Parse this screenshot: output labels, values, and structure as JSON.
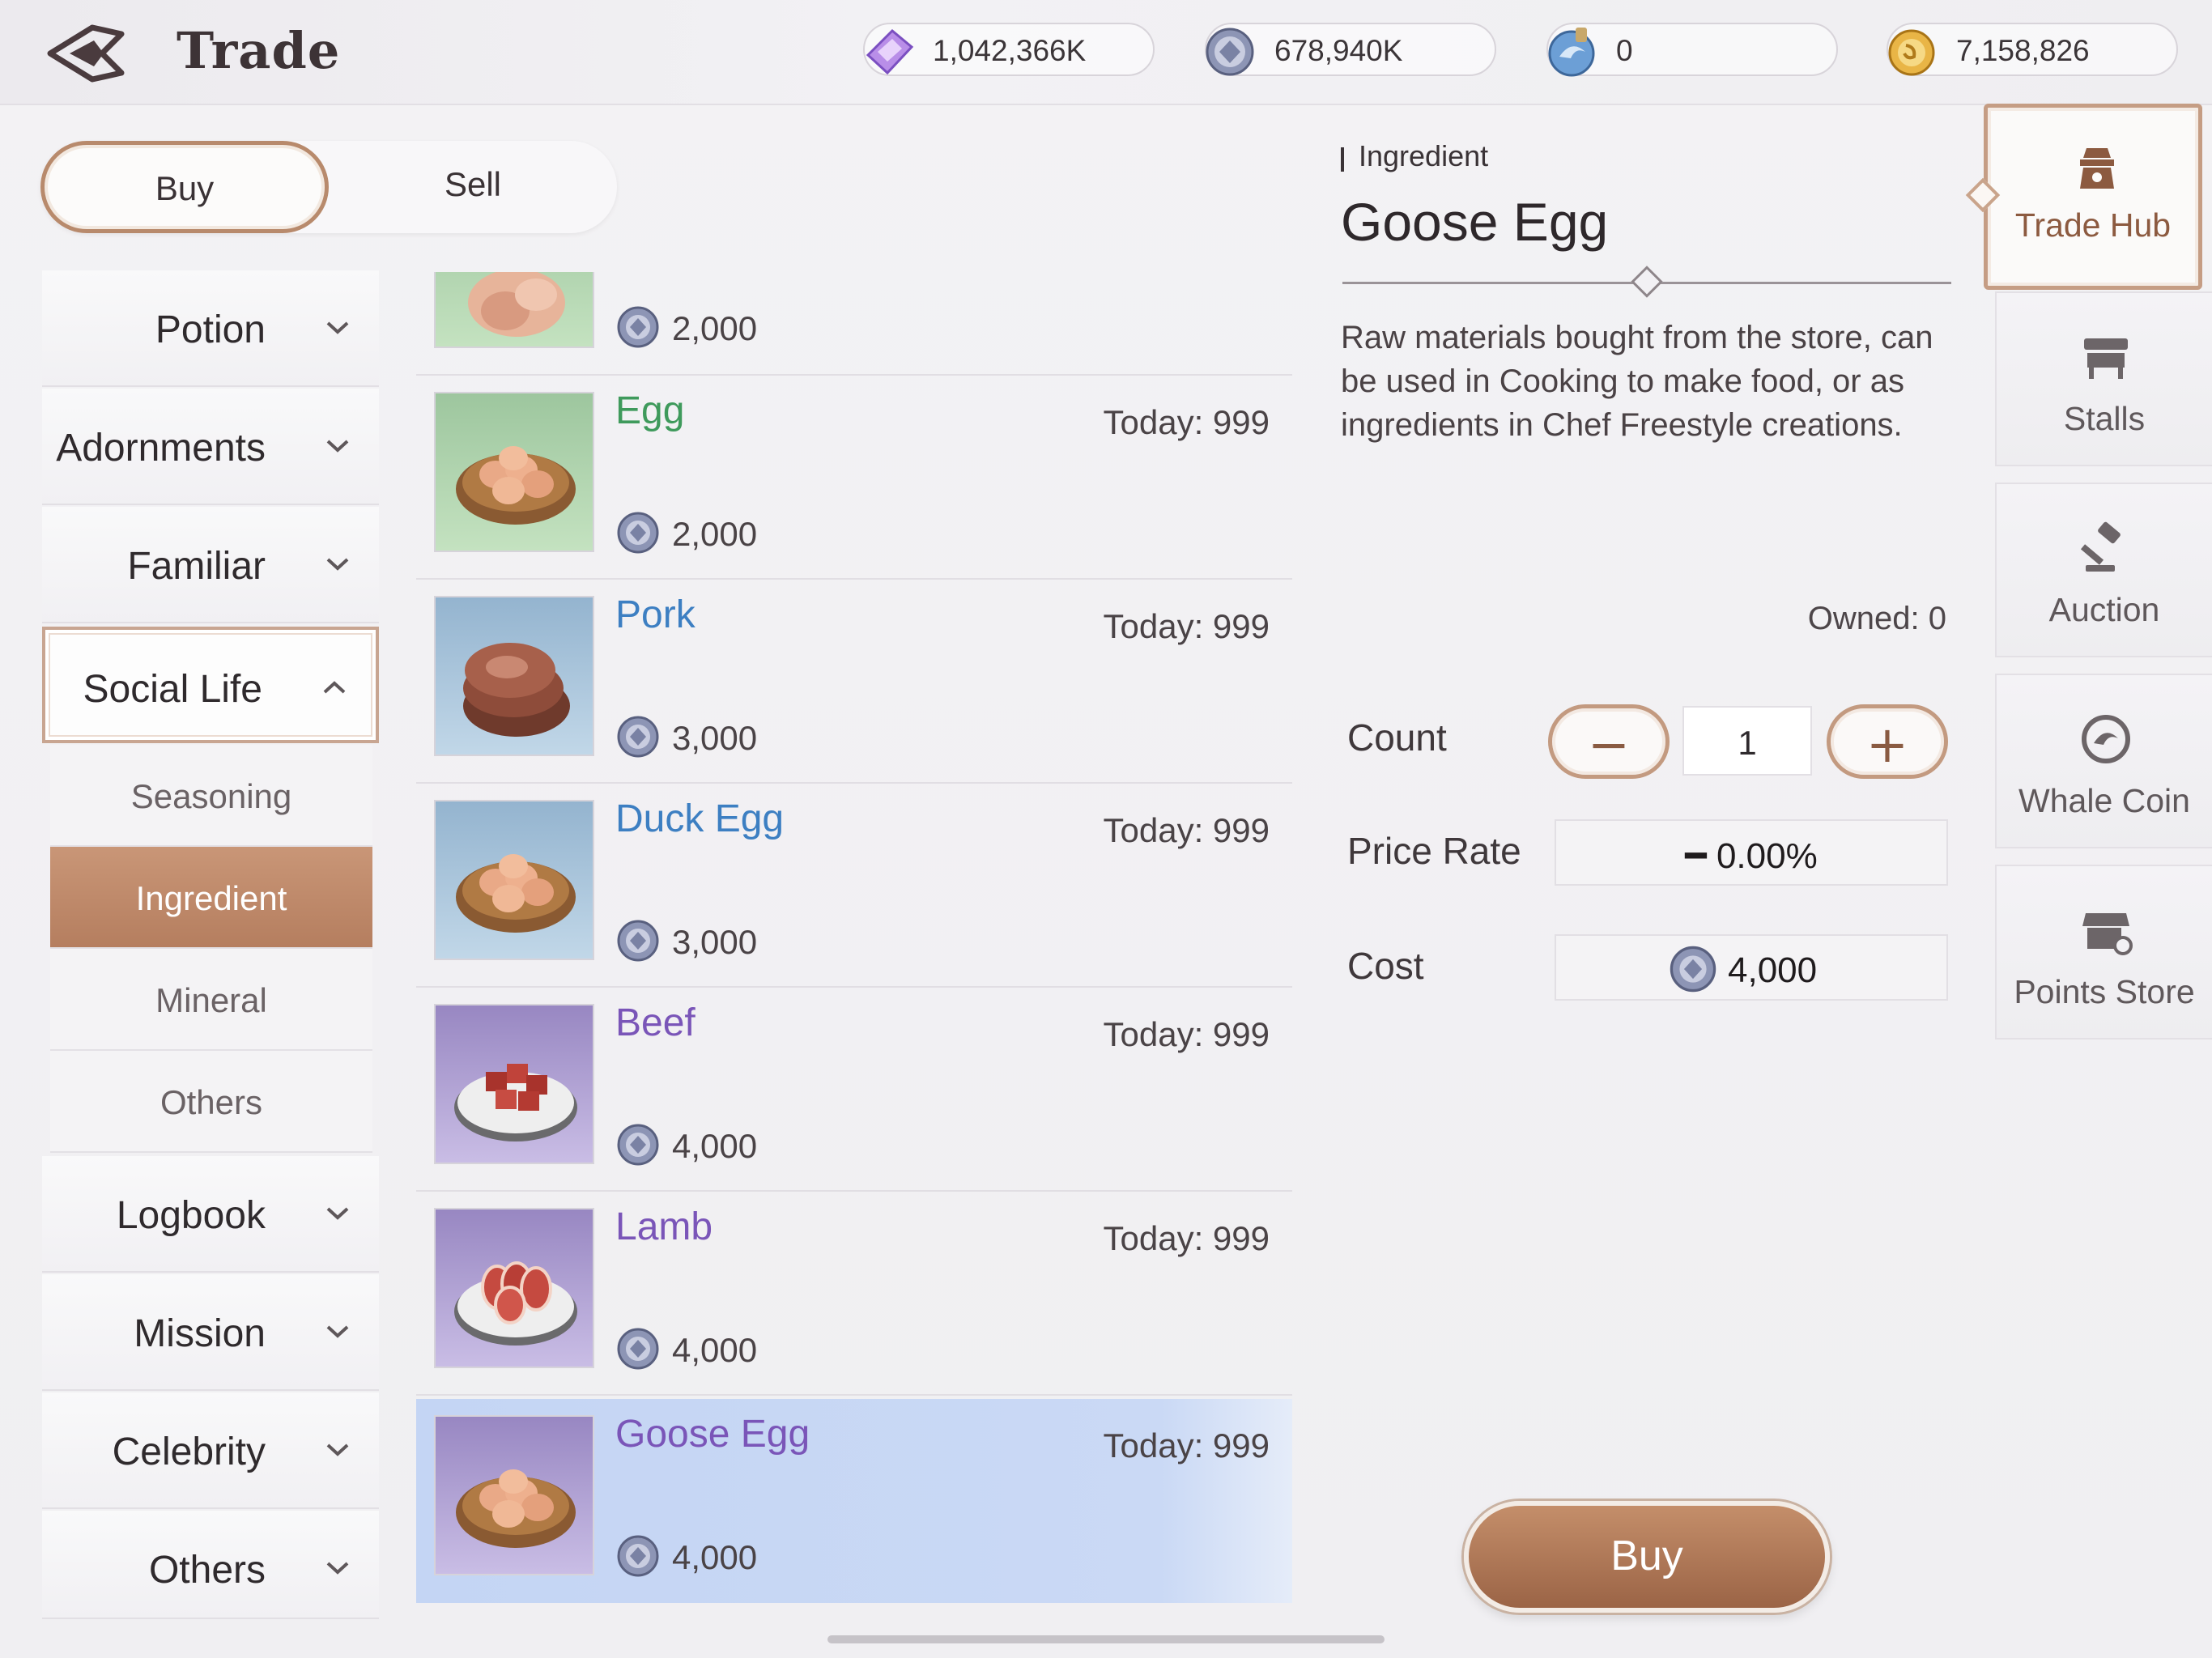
{
  "header": {
    "title": "Trade",
    "currencies": [
      {
        "icon": "diamond-coupon-icon",
        "value": "1,042,366K"
      },
      {
        "icon": "silver-coin-icon",
        "value": "678,940K"
      },
      {
        "icon": "whale-coin-icon",
        "value": "0"
      },
      {
        "icon": "gold-coin-icon",
        "value": "7,158,826"
      }
    ]
  },
  "toggle": {
    "buy": "Buy",
    "sell": "Sell",
    "selected": "Buy"
  },
  "categories": {
    "potion": "Potion",
    "adornments": "Adornments",
    "familiar": "Familiar",
    "social_life": "Social Life",
    "logbook": "Logbook",
    "mission": "Mission",
    "celebrity": "Celebrity",
    "others": "Others",
    "social_life_subs": {
      "seasoning": "Seasoning",
      "ingredient": "Ingredient",
      "mineral": "Mineral",
      "others": "Others"
    }
  },
  "items": [
    {
      "name": "",
      "today": "",
      "price": "2,000",
      "color": "#3f9a5c"
    },
    {
      "name": "Egg",
      "today": "Today: 999",
      "price": "2,000",
      "color": "#3f9a5c"
    },
    {
      "name": "Pork",
      "today": "Today: 999",
      "price": "3,000",
      "color": "#3d7fc2"
    },
    {
      "name": "Duck Egg",
      "today": "Today: 999",
      "price": "3,000",
      "color": "#3d7fc2"
    },
    {
      "name": "Beef",
      "today": "Today: 999",
      "price": "4,000",
      "color": "#7a55b8"
    },
    {
      "name": "Lamb",
      "today": "Today: 999",
      "price": "4,000",
      "color": "#7a55b8"
    },
    {
      "name": "Goose Egg",
      "today": "Today: 999",
      "price": "4,000",
      "color": "#7a55b8"
    }
  ],
  "detail": {
    "category": "Ingredient",
    "title": "Goose Egg",
    "description": "Raw materials bought from the store, can be used in Cooking to make food, or as ingredients in Chef Freestyle creations.",
    "owned": "Owned: 0",
    "count_label": "Count",
    "count_value": "1",
    "minus": "−",
    "plus": "+",
    "price_rate_label": "Price Rate",
    "price_rate_value": "━ 0.00%",
    "cost_label": "Cost",
    "cost_value": "4,000",
    "buy_label": "Buy"
  },
  "right_nav": {
    "trade_hub": "Trade Hub",
    "stalls": "Stalls",
    "auction": "Auction",
    "whale_coin": "Whale Coin",
    "points_store": "Points Store"
  }
}
